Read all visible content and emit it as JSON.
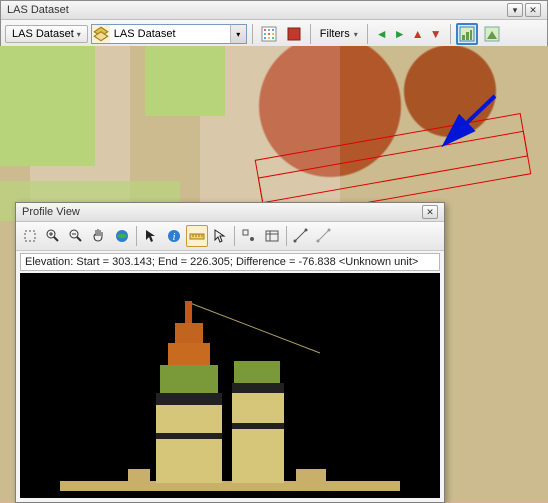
{
  "main": {
    "title": "LAS Dataset",
    "dropdown_label": "LAS Dataset",
    "combo_value": "LAS Dataset",
    "filters_label": "Filters"
  },
  "icons": {
    "points": "points-grid-icon",
    "surface": "surface-square-icon",
    "filters": "filters-icon",
    "arrow_left": "◄",
    "arrow_right": "►",
    "arrow_up": "▲",
    "arrow_down": "▼",
    "profile1": "profile-view-icon",
    "profile2": "three-d-view-icon"
  },
  "profile": {
    "title": "Profile View",
    "status": "Elevation: Start = 303.143;  End = 226.305;  Difference = -76.838 <Unknown unit>"
  },
  "chart_data": {
    "type": "profile",
    "start_elevation": 303.143,
    "end_elevation": 226.305,
    "difference": -76.838,
    "unit": "Unknown unit"
  }
}
